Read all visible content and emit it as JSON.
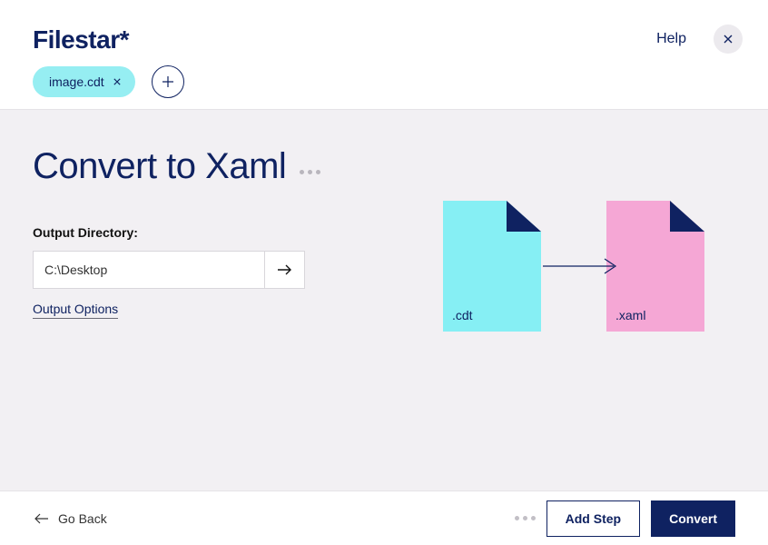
{
  "header": {
    "brand": "Filestar*",
    "help_label": "Help",
    "file_chip": "image.cdt"
  },
  "main": {
    "title": "Convert to Xaml",
    "output_directory_label": "Output Directory:",
    "output_directory_value": "C:\\Desktop",
    "output_options_label": "Output Options",
    "source_ext": ".cdt",
    "target_ext": ".xaml"
  },
  "footer": {
    "go_back_label": "Go Back",
    "add_step_label": "Add Step",
    "convert_label": "Convert"
  },
  "colors": {
    "primary": "#0f2261",
    "chip_bg": "#96eef2",
    "src_file": "#86eff4",
    "dst_file": "#f5a7d5",
    "main_bg": "#f2f0f3"
  }
}
